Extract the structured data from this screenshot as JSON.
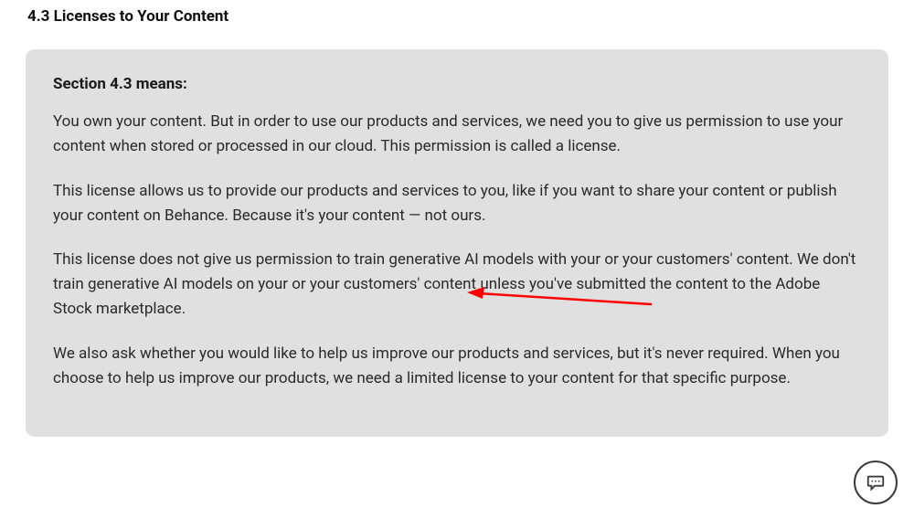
{
  "heading": "4.3 Licenses to Your Content",
  "callout": {
    "title": "Section 4.3 means:",
    "paragraphs": [
      "You own your content. But in order to use our products and services, we need you to give us permission to use your content when stored or processed in our cloud. This permission is called a license.",
      "This license allows us to provide our products and services to you, like if you want to share your content or publish your content on Behance. Because it's your content — not ours.",
      "This license does not give us permission to train generative AI models with your or your customers' content. We don't train generative AI models on your or your customers' content unless you've submitted the content to the Adobe Stock marketplace.",
      "We also ask whether you would like to help us improve our products and services, but it's never required. When you choose to help us improve our products, we need a limited license to your content for that specific purpose."
    ]
  },
  "annotation": {
    "arrow_color": "#ff0000"
  },
  "chat_icon_name": "chat"
}
